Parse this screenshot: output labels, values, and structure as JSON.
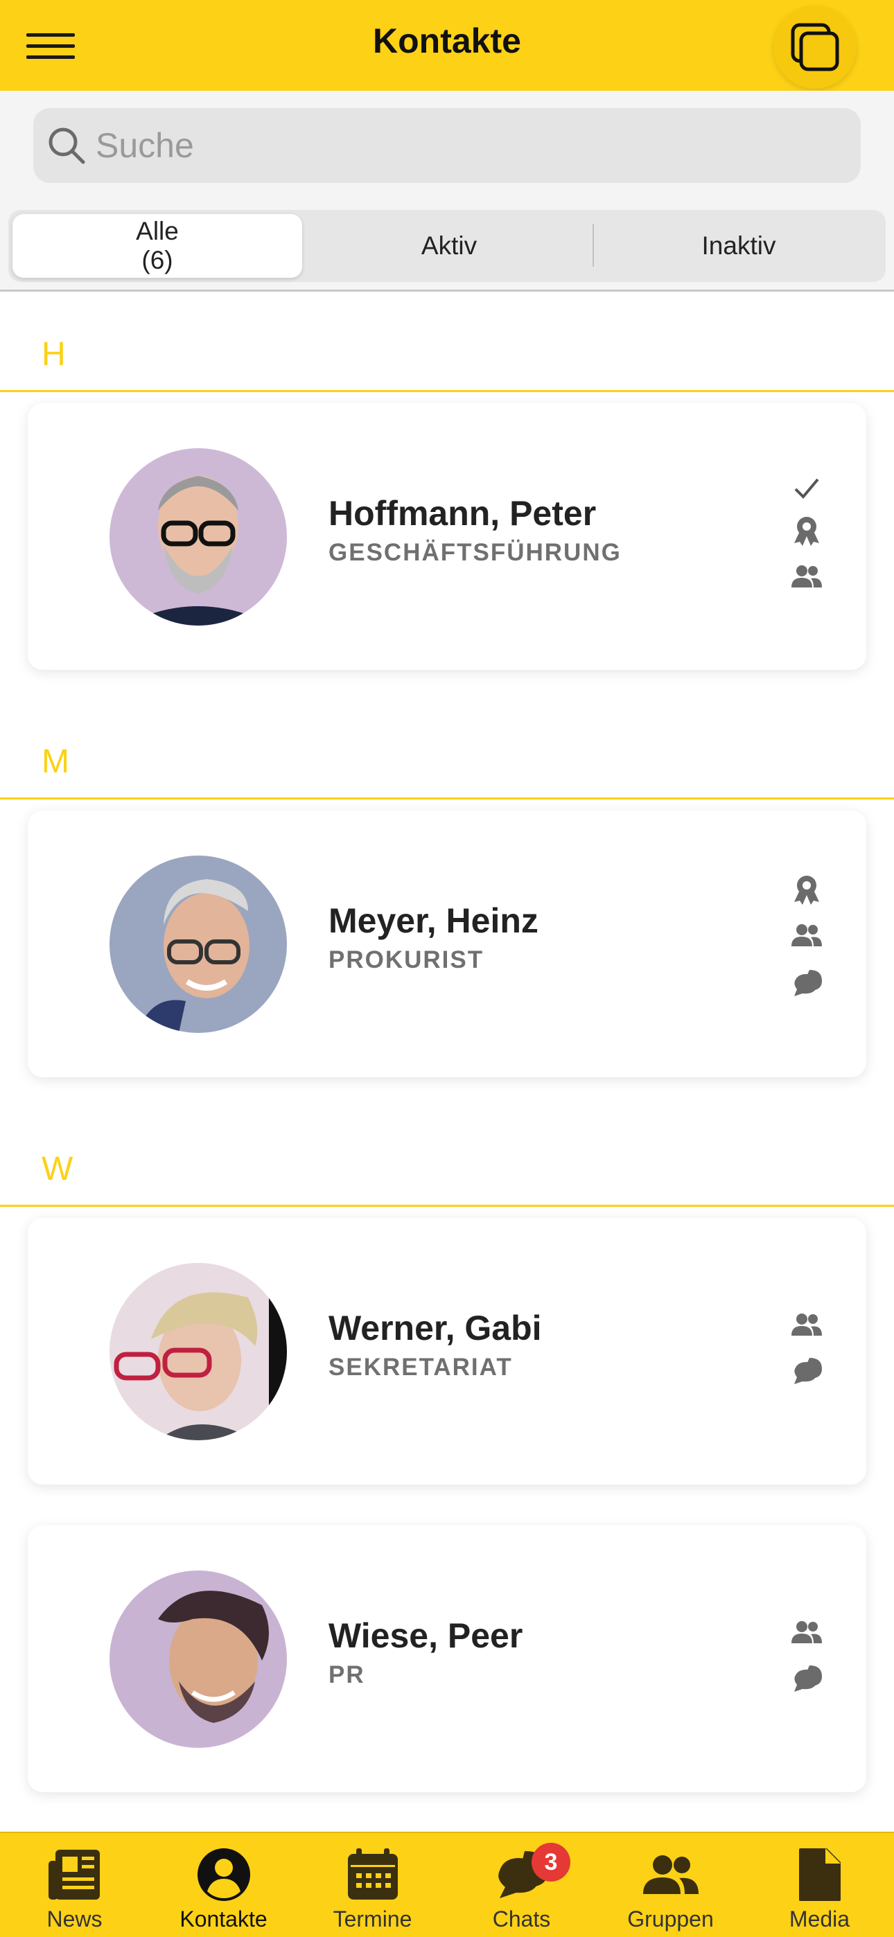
{
  "header": {
    "title": "Kontakte"
  },
  "search": {
    "placeholder": "Suche",
    "value": ""
  },
  "segments": [
    {
      "label": "Alle",
      "count": "(6)",
      "active": true
    },
    {
      "label": "Aktiv",
      "active": false
    },
    {
      "label": "Inaktiv",
      "active": false
    }
  ],
  "sections": [
    {
      "letter": "H",
      "contacts": [
        {
          "name": "Hoffmann, Peter",
          "role": "GESCHÄFTSFÜHRUNG",
          "icons": [
            "check-icon",
            "award-icon",
            "group-icon"
          ]
        }
      ]
    },
    {
      "letter": "M",
      "contacts": [
        {
          "name": "Meyer, Heinz",
          "role": "PROKURIST",
          "icons": [
            "award-icon",
            "group-icon",
            "chat-icon"
          ]
        }
      ]
    },
    {
      "letter": "W",
      "contacts": [
        {
          "name": "Werner, Gabi",
          "role": "SEKRETARIAT",
          "icons": [
            "group-icon",
            "chat-icon"
          ]
        },
        {
          "name": "Wiese, Peer",
          "role": "PR",
          "icons": [
            "group-icon",
            "chat-icon"
          ]
        }
      ]
    }
  ],
  "tabbar": {
    "tabs": [
      {
        "label": "News",
        "icon": "newspaper-icon"
      },
      {
        "label": "Kontakte",
        "icon": "user-circle-icon",
        "active": true
      },
      {
        "label": "Termine",
        "icon": "calendar-icon"
      },
      {
        "label": "Chats",
        "icon": "chats-icon",
        "badge": "3"
      },
      {
        "label": "Gruppen",
        "icon": "group-icon"
      },
      {
        "label": "Media",
        "icon": "file-icon"
      }
    ]
  },
  "colors": {
    "accent": "#fcd116",
    "badge": "#e53935",
    "icon_gray": "#6b6b6b"
  }
}
